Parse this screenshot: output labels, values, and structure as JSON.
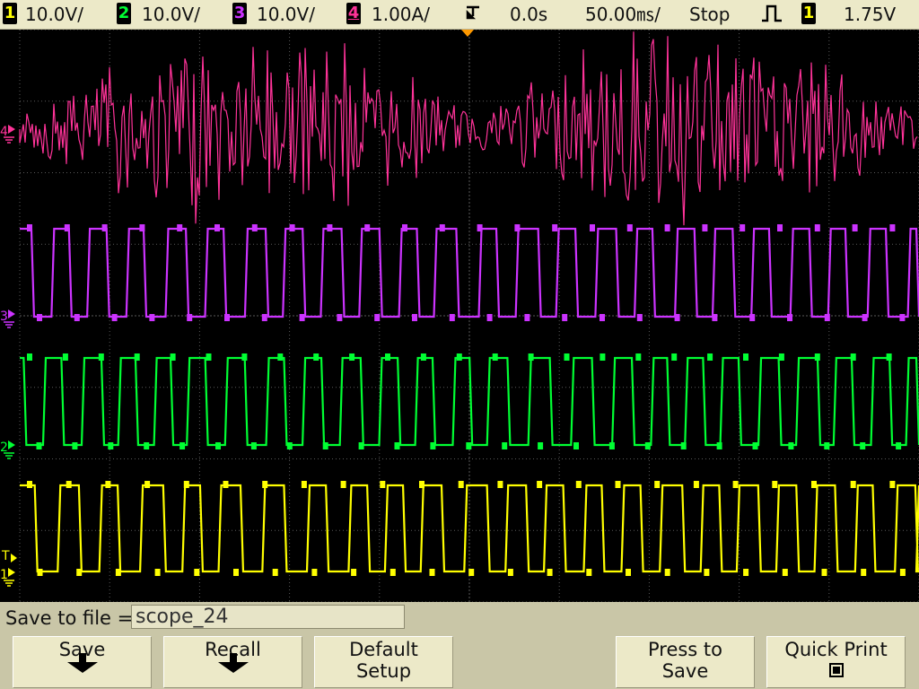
{
  "status_bar": {
    "channels": [
      {
        "num": "1",
        "scale": "10.0V/",
        "color": "#ffff00"
      },
      {
        "num": "2",
        "scale": "10.0V/",
        "color": "#00ff33"
      },
      {
        "num": "3",
        "scale": "10.0V/",
        "color": "#cc33ff"
      },
      {
        "num": "4",
        "scale": "1.00A/",
        "color": "#ff3399"
      }
    ],
    "time_delay": "0.0s",
    "time_scale": "50.00㎳/",
    "run_state": "Stop",
    "trigger_source": "1",
    "trigger_level": "1.75V"
  },
  "screen": {
    "markers": {
      "ch4": "4",
      "ch3": "3",
      "ch2": "2",
      "ch1": "1",
      "trigger": "T"
    }
  },
  "save_panel": {
    "label": "Save to file =",
    "filename": "scope_24"
  },
  "softkeys": {
    "save": "Save",
    "recall": "Recall",
    "default_setup_line1": "Default",
    "default_setup_line2": "Setup",
    "press_to_save_line1": "Press to",
    "press_to_save_line2": "Save",
    "quick_print": "Quick Print"
  },
  "colors": {
    "ch1": "#ffff00",
    "ch2": "#00ff33",
    "ch3": "#cc33ff",
    "ch4": "#ff3399",
    "trigger_marker": "#ff9900",
    "grid": "#5a5a5a",
    "panel": "#ece9c8"
  }
}
